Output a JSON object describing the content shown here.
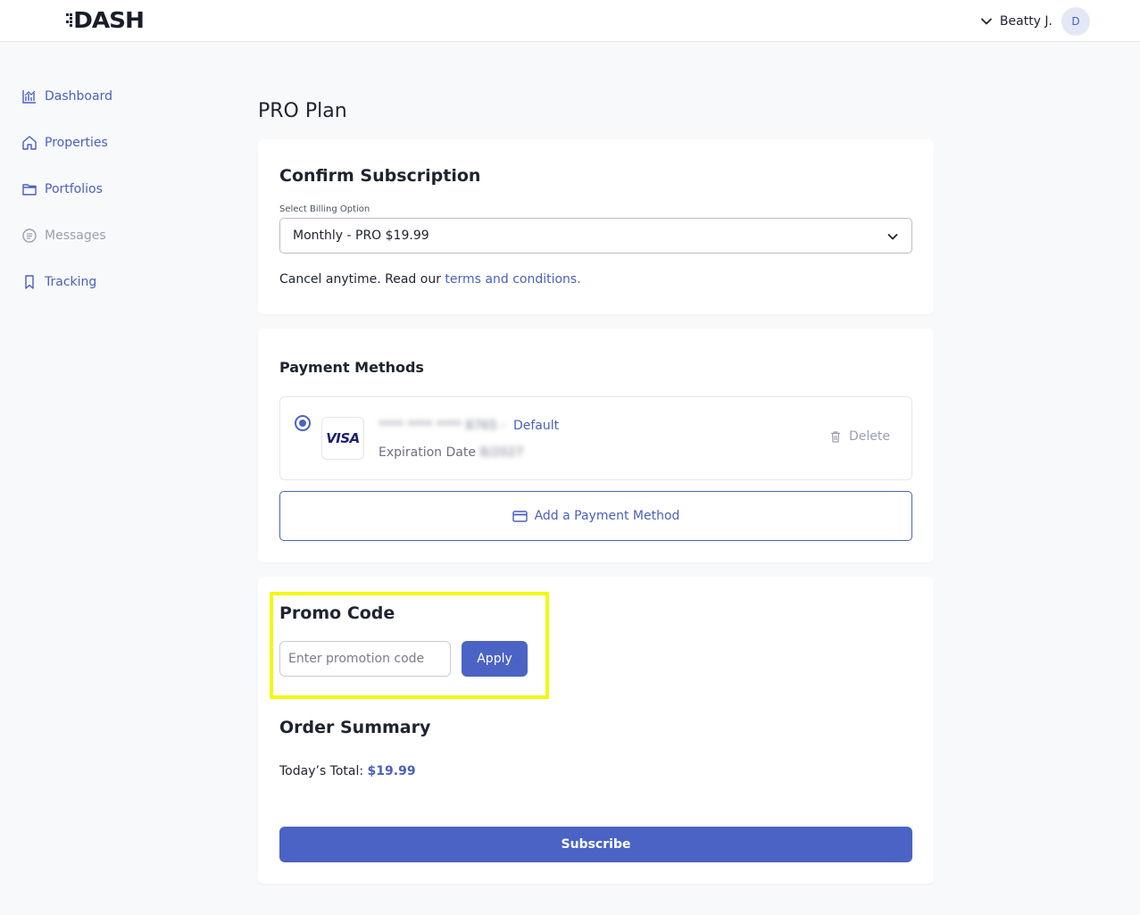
{
  "header": {
    "logo_text": "DASH",
    "user_name": "Beatty J.",
    "avatar_initial": "D"
  },
  "sidebar": {
    "items": [
      {
        "label": "Dashboard",
        "icon": "chart-icon"
      },
      {
        "label": "Properties",
        "icon": "home-icon"
      },
      {
        "label": "Portfolios",
        "icon": "folder-icon"
      },
      {
        "label": "Messages",
        "icon": "message-icon"
      },
      {
        "label": "Tracking",
        "icon": "bookmark-icon"
      }
    ]
  },
  "page": {
    "title": "PRO Plan"
  },
  "subscription": {
    "title": "Confirm Subscription",
    "billing_label": "Select Billing Option",
    "billing_value": "Monthly - PRO $19.99",
    "cancel_text": "Cancel anytime. Read our ",
    "terms_link": "terms and conditions."
  },
  "payment": {
    "title": "Payment Methods",
    "card_brand": "VISA",
    "card_number": "**** **** **** 8765",
    "card_separator": " - ",
    "default_label": "Default",
    "expiration_label": "Expiration Date ",
    "expiration_value": "8/2027",
    "delete_label": "Delete",
    "add_label": "Add a Payment Method"
  },
  "promo": {
    "title": "Promo Code",
    "placeholder": "Enter promotion code",
    "apply_label": "Apply"
  },
  "summary": {
    "title": "Order Summary",
    "total_label": "Today’s Total: ",
    "total_value": "$19.99",
    "subscribe_label": "Subscribe"
  },
  "colors": {
    "accent": "#4a63c4",
    "link": "#4a5fbd",
    "highlight": "#f2f90e",
    "background": "#f8f9fb"
  }
}
